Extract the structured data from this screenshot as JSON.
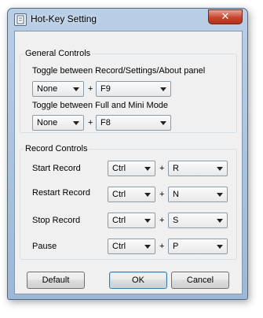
{
  "window": {
    "title": "Hot-Key Setting",
    "close_glyph": "✕"
  },
  "general": {
    "legend": "General Controls",
    "rows": [
      {
        "label": "Toggle between Record/Settings/About panel",
        "modifier": "None",
        "key": "F9"
      },
      {
        "label": "Toggle between Full and Mini Mode",
        "modifier": "None",
        "key": "F8"
      }
    ]
  },
  "record": {
    "legend": "Record Controls",
    "rows": [
      {
        "label": "Start Record",
        "modifier": "Ctrl",
        "key": "R"
      },
      {
        "label": "Restart Record",
        "modifier": "Ctrl",
        "key": "N"
      },
      {
        "label": "Stop Record",
        "modifier": "Ctrl",
        "key": "S"
      },
      {
        "label": "Pause",
        "modifier": "Ctrl",
        "key": "P"
      }
    ]
  },
  "plus": "+",
  "buttons": {
    "default": "Default",
    "ok": "OK",
    "cancel": "Cancel"
  }
}
